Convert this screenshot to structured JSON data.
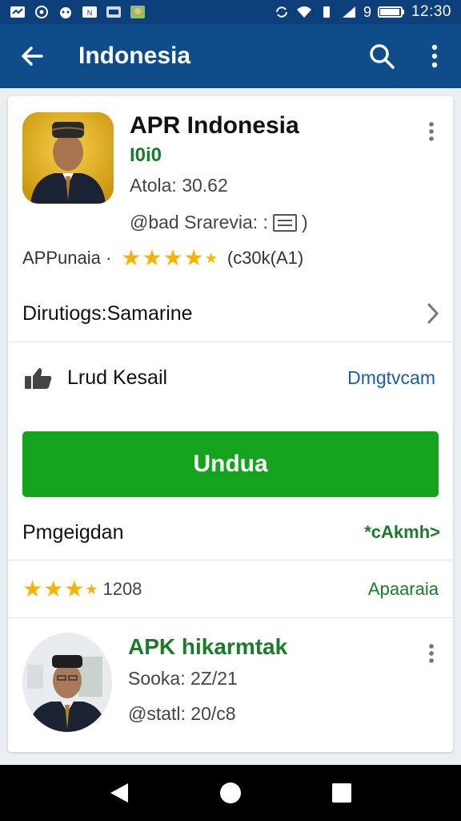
{
  "status_bar": {
    "time": "12:30",
    "battery": "9"
  },
  "app_bar": {
    "title": "Indonesia"
  },
  "app": {
    "name": "APR Indonesia",
    "subtitle": "I0i0",
    "version": "Atola: 30.62",
    "developer": "@bad Srarevia: :",
    "developer_suffix": ")",
    "category": "APPunaia ·",
    "rating_text": "(c30k(A1)",
    "rating_value": 4.5
  },
  "distribution": {
    "label": "Dirutiogs:Samarine"
  },
  "feature": {
    "label": "Lrud Kesail",
    "link": "Dmgtvcam"
  },
  "install": {
    "label": "Undua"
  },
  "permissions": {
    "label": "Pmgeigdan",
    "link": "*cAkmh>"
  },
  "reviews": {
    "count": "1208",
    "link": "Apaaraia",
    "rating_value": 3
  },
  "related": {
    "title": "APK hikarmtak",
    "version": "Sooka: 2Z/21",
    "size": "@statl: 20/c8"
  },
  "colors": {
    "status_bar": "#0d3f7a",
    "app_bar": "#0f4c8a",
    "install_button": "#15a21d",
    "accent_green": "#1b7a2c",
    "link_blue": "#1a5fa8",
    "star": "#f4b400"
  },
  "icons": {
    "back": "arrow-left-icon",
    "search": "search-icon",
    "more": "more-vert-icon",
    "chevron": "chevron-right-icon",
    "thumb": "thumbs-up-icon"
  }
}
